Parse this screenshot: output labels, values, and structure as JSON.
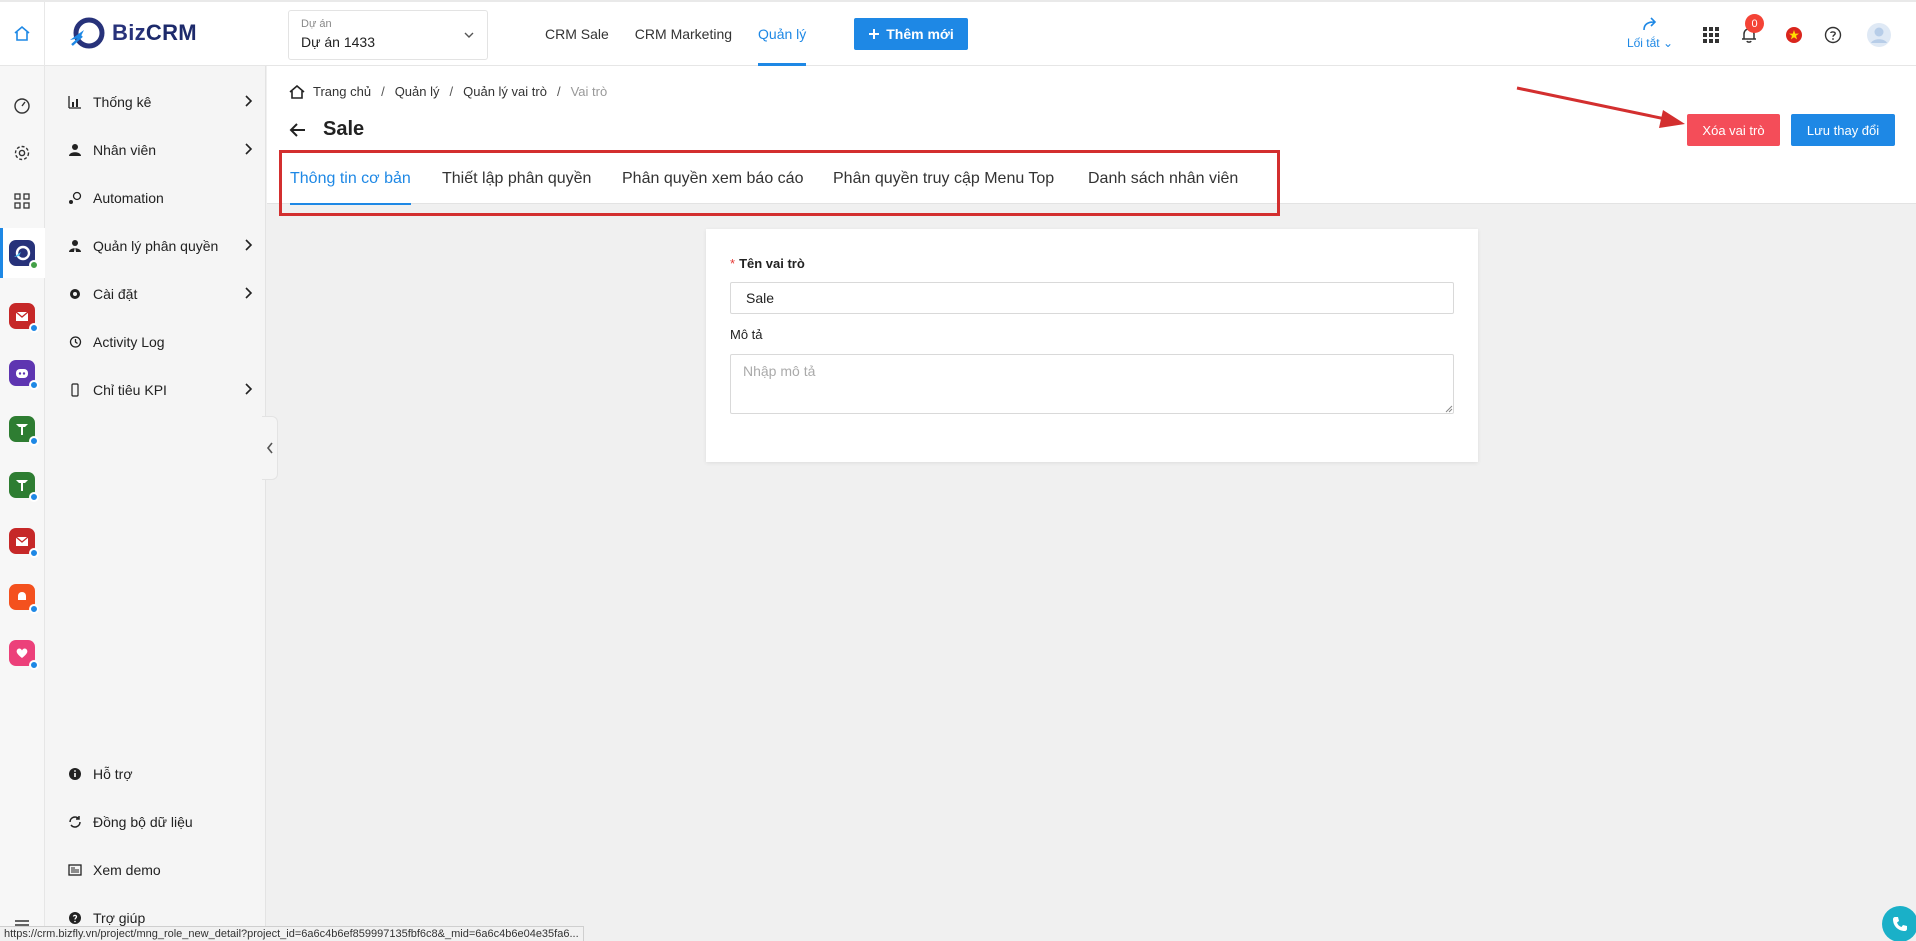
{
  "header": {
    "logo_text_biz": "Biz",
    "logo_text_crm": "CRM",
    "project_label": "Dự án",
    "project_value": "Dự án 1433",
    "nav": [
      {
        "label": "CRM Sale"
      },
      {
        "label": "CRM Marketing"
      },
      {
        "label": "Quản lý"
      }
    ],
    "add_button": "Thêm mới",
    "shortcut_label": "Lối tắt",
    "notification_count": "0"
  },
  "sidebar": {
    "items": [
      {
        "label": "Thống kê"
      },
      {
        "label": "Nhân viên"
      },
      {
        "label": "Automation"
      },
      {
        "label": "Quản lý phân quyền"
      },
      {
        "label": "Cài đặt"
      },
      {
        "label": "Activity Log"
      },
      {
        "label": "Chỉ tiêu KPI"
      }
    ],
    "bottom_items": [
      {
        "label": "Hỗ trợ"
      },
      {
        "label": "Đồng bộ dữ liệu"
      },
      {
        "label": "Xem demo"
      },
      {
        "label": "Trợ giúp"
      }
    ]
  },
  "breadcrumb": {
    "items": [
      "Trang chủ",
      "Quản lý",
      "Quản lý vai trò",
      "Vai trò"
    ]
  },
  "page": {
    "title": "Sale",
    "delete_button": "Xóa vai trò",
    "save_button": "Lưu thay đổi",
    "tabs": [
      {
        "label": "Thông tin cơ bản"
      },
      {
        "label": "Thiết lập phân quyền"
      },
      {
        "label": "Phân quyền xem báo cáo"
      },
      {
        "label": "Phân quyền truy cập Menu Top"
      },
      {
        "label": "Danh sách nhân viên"
      }
    ]
  },
  "form": {
    "role_name_label": "Tên vai trò",
    "required_mark": "*",
    "role_name_value": "Sale",
    "description_label": "Mô tả",
    "description_placeholder": "Nhập mô tả"
  },
  "statusbar": {
    "url": "https://crm.bizfly.vn/project/mng_role_new_detail?project_id=6a6c4b6ef859997135fbf6c8&_mid=6a6c4b6e04e35fa6..."
  },
  "colors": {
    "accent": "#1e88e5",
    "danger": "#f44d59",
    "annotation": "#d32f2f"
  }
}
